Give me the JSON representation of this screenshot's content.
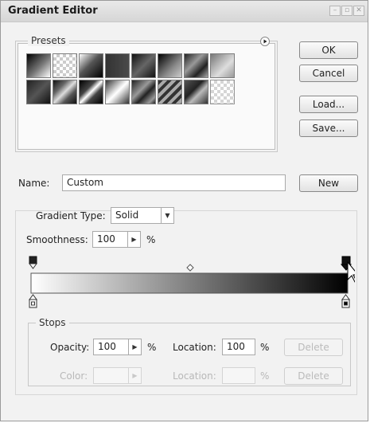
{
  "window": {
    "title": "Gradient Editor"
  },
  "presets": {
    "legend": "Presets",
    "menu_icon": "triangle-right-icon"
  },
  "buttons": {
    "ok": "OK",
    "cancel": "Cancel",
    "load": "Load...",
    "save": "Save...",
    "new": "New"
  },
  "name": {
    "label": "Name:",
    "value": "Custom"
  },
  "gradient": {
    "type_label": "Gradient Type:",
    "type_value": "Solid",
    "smoothness_label": "Smoothness:",
    "smoothness_value": "100",
    "smoothness_unit": "%",
    "start_color": "#ffffff",
    "end_color": "#000000"
  },
  "stops": {
    "legend": "Stops",
    "opacity_label": "Opacity:",
    "opacity_value": "100",
    "opacity_unit": "%",
    "location_label": "Location:",
    "location_value": "100",
    "location_unit": "%",
    "delete_label": "Delete",
    "color_label": "Color:",
    "color_location_label": "Location:",
    "color_location_unit": "%",
    "color_delete_label": "Delete"
  }
}
